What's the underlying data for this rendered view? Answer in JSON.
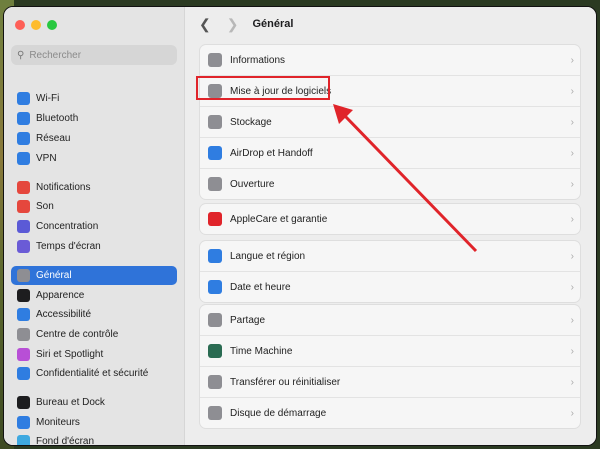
{
  "window": {
    "title": "Général"
  },
  "search": {
    "placeholder": "Rechercher"
  },
  "sidebar": {
    "items": [
      {
        "label": "Wi-Fi",
        "icon": "wifi-icon",
        "color": "#2f7de1"
      },
      {
        "label": "Bluetooth",
        "icon": "bluetooth-icon",
        "color": "#2f7de1"
      },
      {
        "label": "Réseau",
        "icon": "globe-icon",
        "color": "#2f7de1"
      },
      {
        "label": "VPN",
        "icon": "vpn-icon",
        "color": "#2f7de1"
      },
      {
        "label": "Notifications",
        "icon": "bell-icon",
        "color": "#e5473d"
      },
      {
        "label": "Son",
        "icon": "speaker-icon",
        "color": "#e5473d"
      },
      {
        "label": "Concentration",
        "icon": "moon-icon",
        "color": "#5b5ad6"
      },
      {
        "label": "Temps d'écran",
        "icon": "hourglass-icon",
        "color": "#6a5bd6"
      },
      {
        "label": "Général",
        "icon": "gear-icon",
        "color": "#8e8e93"
      },
      {
        "label": "Apparence",
        "icon": "appearance-icon",
        "color": "#1d1d1f"
      },
      {
        "label": "Accessibilité",
        "icon": "accessibility-icon",
        "color": "#2f7de1"
      },
      {
        "label": "Centre de contrôle",
        "icon": "control-center-icon",
        "color": "#8e8e93"
      },
      {
        "label": "Siri et Spotlight",
        "icon": "siri-icon",
        "color": "#b84fd6"
      },
      {
        "label": "Confidentialité et sécurité",
        "icon": "hand-icon",
        "color": "#2f7de1"
      },
      {
        "label": "Bureau et Dock",
        "icon": "dock-icon",
        "color": "#1d1d1f"
      },
      {
        "label": "Moniteurs",
        "icon": "display-icon",
        "color": "#2f7de1"
      },
      {
        "label": "Fond d'écran",
        "icon": "wallpaper-icon",
        "color": "#3fa9e0"
      }
    ]
  },
  "main": {
    "groups": [
      [
        {
          "label": "Informations",
          "icon": "info-icon",
          "color": "#8e8e93"
        },
        {
          "label": "Mise à jour de logiciels",
          "icon": "software-update-icon",
          "color": "#8e8e93"
        },
        {
          "label": "Stockage",
          "icon": "storage-icon",
          "color": "#8e8e93"
        },
        {
          "label": "AirDrop et Handoff",
          "icon": "airdrop-icon",
          "color": "#2f7de1"
        },
        {
          "label": "Ouverture",
          "icon": "login-items-icon",
          "color": "#8e8e93"
        }
      ],
      [
        {
          "label": "AppleCare et garantie",
          "icon": "apple-icon",
          "color": "#e0242a"
        }
      ],
      [
        {
          "label": "Langue et région",
          "icon": "language-globe-icon",
          "color": "#2f7de1"
        },
        {
          "label": "Date et heure",
          "icon": "calendar-clock-icon",
          "color": "#2f7de1"
        }
      ],
      [
        {
          "label": "Partage",
          "icon": "sharing-icon",
          "color": "#8e8e93"
        },
        {
          "label": "Time Machine",
          "icon": "time-machine-icon",
          "color": "#2a6b52"
        },
        {
          "label": "Transférer ou réinitialiser",
          "icon": "reset-icon",
          "color": "#8e8e93"
        },
        {
          "label": "Disque de démarrage",
          "icon": "startup-disk-icon",
          "color": "#8e8e93"
        }
      ]
    ]
  },
  "annotation": {
    "color": "#e0242a"
  }
}
